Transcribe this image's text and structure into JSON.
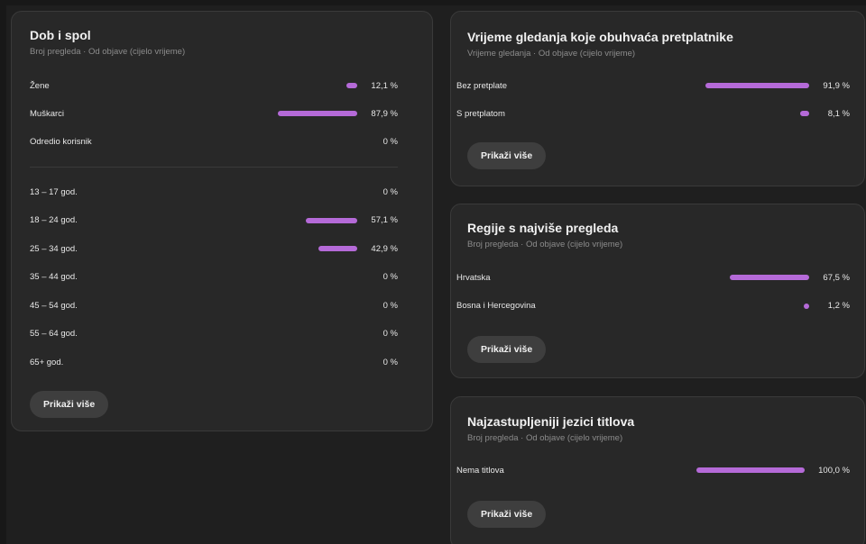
{
  "demographics": {
    "title": "Dob i spol",
    "subtitle": "Broj pregleda · Od objave (cijelo vrijeme)",
    "gender": [
      {
        "label": "Žene",
        "value": "12,1 %",
        "pct": 12.1
      },
      {
        "label": "Muškarci",
        "value": "87,9 %",
        "pct": 87.9
      },
      {
        "label": "Odredio korisnik",
        "value": "0 %",
        "pct": 0
      }
    ],
    "age": [
      {
        "label": "13 – 17 god.",
        "value": "0 %",
        "pct": 0
      },
      {
        "label": "18 – 24 god.",
        "value": "57,1 %",
        "pct": 57.1
      },
      {
        "label": "25 – 34 god.",
        "value": "42,9 %",
        "pct": 42.9
      },
      {
        "label": "35 – 44 god.",
        "value": "0 %",
        "pct": 0
      },
      {
        "label": "45 – 54 god.",
        "value": "0 %",
        "pct": 0
      },
      {
        "label": "55 – 64 god.",
        "value": "0 %",
        "pct": 0
      },
      {
        "label": "65+ god.",
        "value": "0 %",
        "pct": 0
      }
    ],
    "show_more": "Prikaži više"
  },
  "subscribers": {
    "title": "Vrijeme gledanja koje obuhvaća pretplatnike",
    "subtitle": "Vrijeme gledanja · Od objave (cijelo vrijeme)",
    "rows": [
      {
        "label": "Bez pretplate",
        "value": "91,9 %",
        "pct": 91.9
      },
      {
        "label": "S pretplatom",
        "value": "8,1 %",
        "pct": 8.1
      }
    ],
    "show_more": "Prikaži više"
  },
  "regions": {
    "title": "Regije s najviše pregleda",
    "subtitle": "Broj pregleda · Od objave (cijelo vrijeme)",
    "rows": [
      {
        "label": "Hrvatska",
        "value": "67,5 %",
        "pct": 67.5
      },
      {
        "label": "Bosna i Hercegovina",
        "value": "1,2 %",
        "pct": 1.2
      }
    ],
    "show_more": "Prikaži više"
  },
  "subtitles": {
    "title": "Najzastupljeniji jezici titlova",
    "subtitle": "Broj pregleda · Od objave (cijelo vrijeme)",
    "rows": [
      {
        "label": "Nema titlova",
        "value": "100,0 %",
        "pct": 100
      }
    ],
    "show_more": "Prikaži više"
  },
  "colors": {
    "accent": "#b56ad8",
    "card": "#282828",
    "background": "#1f1f1f"
  }
}
